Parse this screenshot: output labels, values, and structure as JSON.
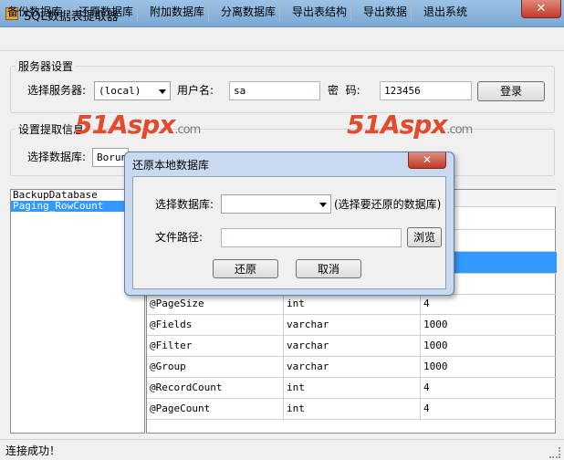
{
  "window": {
    "title": "SQL数据表提取器",
    "close_label": "✕"
  },
  "menu": [
    "备份数据库",
    "还原数据库",
    "附加数据库",
    "分离数据库",
    "导出表结构",
    "导出数据",
    "退出系统"
  ],
  "server_group": {
    "title": "服务器设置",
    "server_label": "选择服务器:",
    "server_value": "(local)",
    "user_label": "用户名:",
    "user_value": "sa",
    "password_label": "密  码:",
    "password_value": "123456",
    "login_button": "登录"
  },
  "extract_group": {
    "title": "设置提取信息",
    "db_label": "选择数据库:",
    "db_value": "Borun"
  },
  "watermark": {
    "brand": "51Aspx",
    "suffix": ".com"
  },
  "proc_list": [
    {
      "name": "BackupDatabase",
      "selected": false
    },
    {
      "name": "Paging_RowCount",
      "selected": true
    }
  ],
  "grid_rows": [
    [
      "@PageSize",
      "int",
      "4"
    ],
    [
      "@Fields",
      "varchar",
      "1000"
    ],
    [
      "@Filter",
      "varchar",
      "1000"
    ],
    [
      "@Group",
      "varchar",
      "1000"
    ],
    [
      "@RecordCount",
      "int",
      "4"
    ],
    [
      "@PageCount",
      "int",
      "4"
    ]
  ],
  "status": "连接成功！",
  "dialog": {
    "title": "还原本地数据库",
    "close_label": "✕",
    "db_label": "选择数据库:",
    "db_value": "",
    "db_hint": "(选择要还原的数据库)",
    "path_label": "文件路径:",
    "path_value": "",
    "browse_button": "浏览",
    "restore_button": "还原",
    "cancel_button": "取消"
  },
  "colors": {
    "accent": "#3399ff",
    "watermark": "#e24b2d",
    "dialog_frame": "#c9daf0"
  }
}
